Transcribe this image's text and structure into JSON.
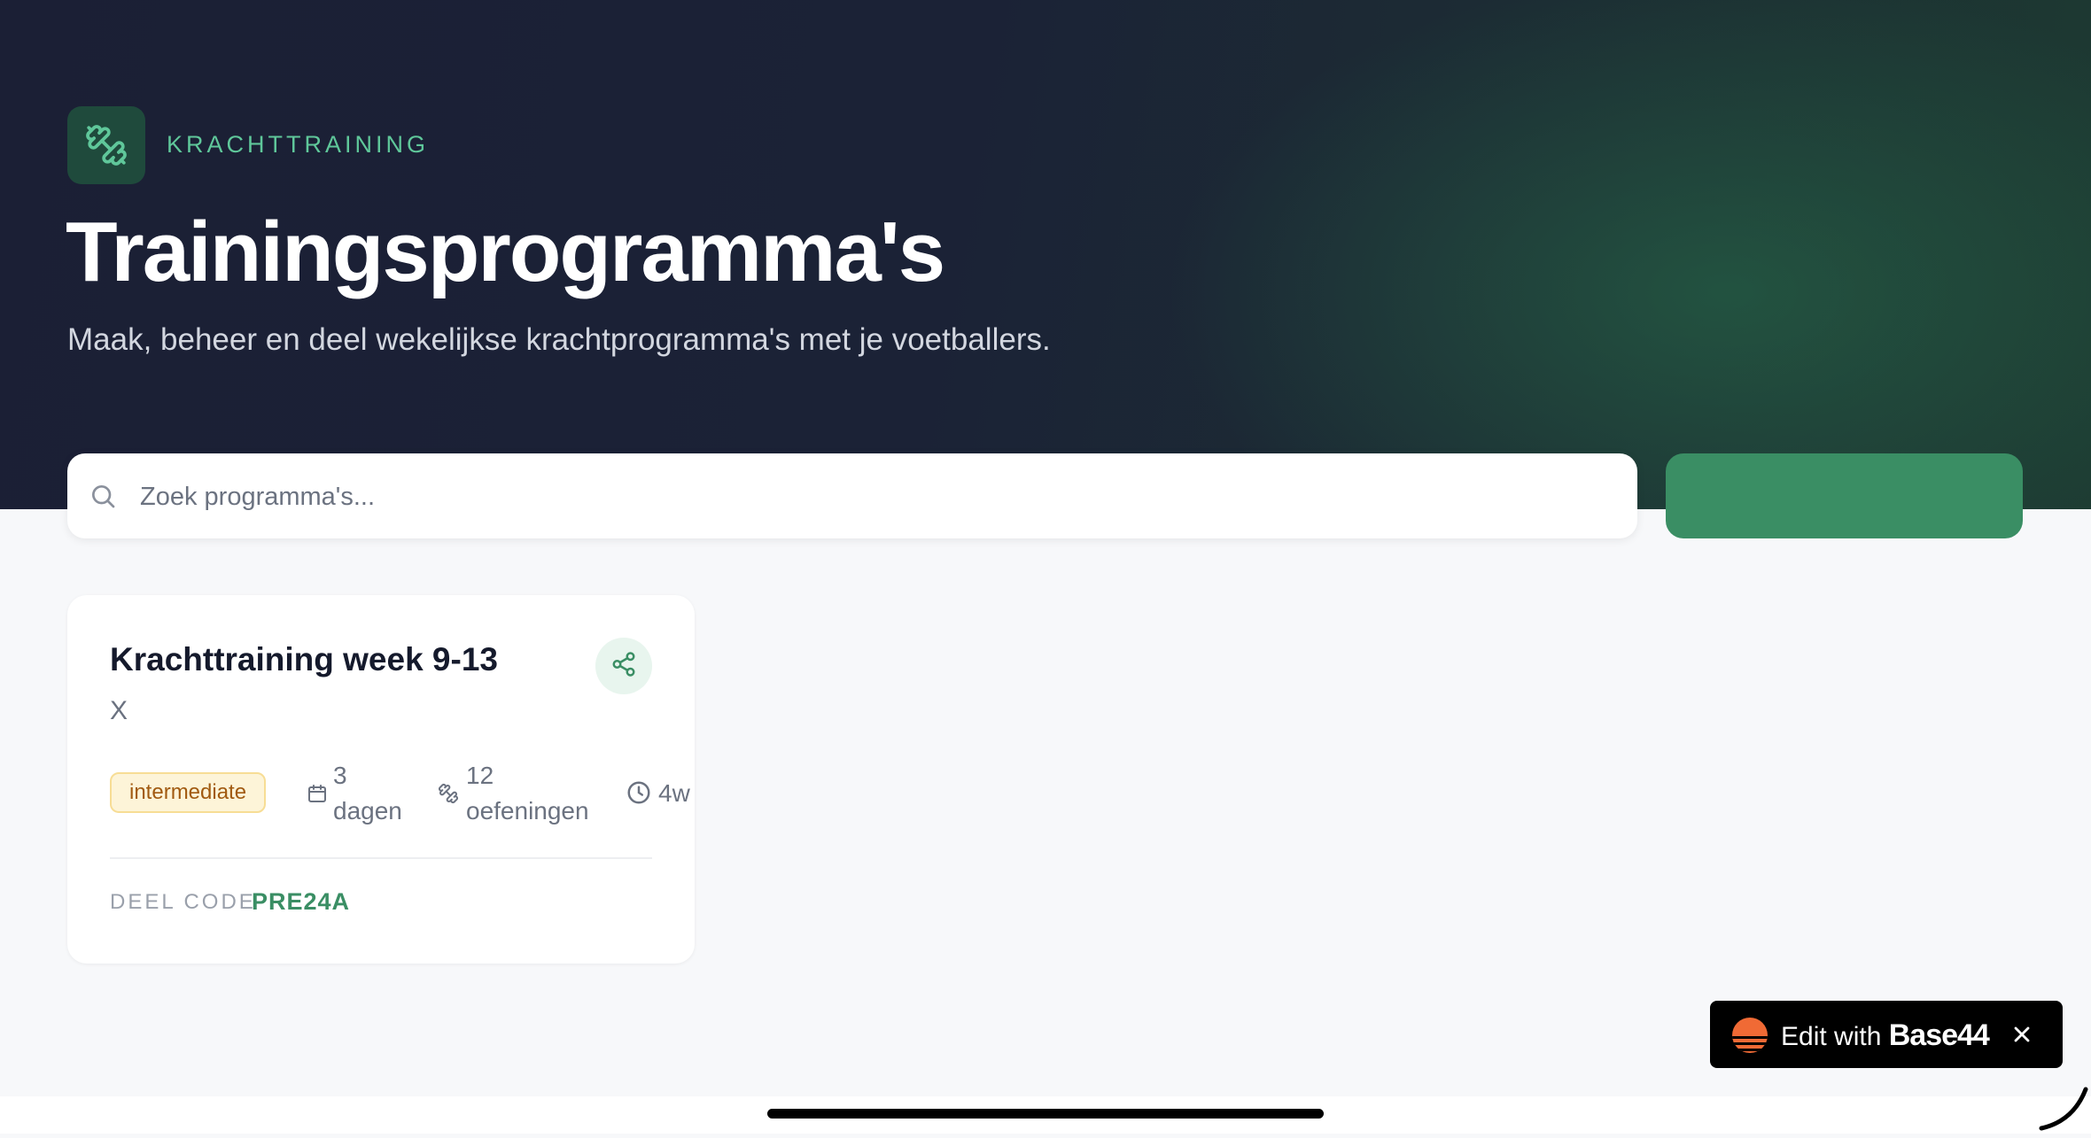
{
  "header": {
    "brand_label": "KRACHTTRAINING",
    "brand_icon": "dumbbell-icon",
    "title": "Trainingsprogramma's",
    "subtitle": "Maak, beheer en deel wekelijkse krachtprogramma's met je voetballers."
  },
  "search": {
    "placeholder": "Zoek programma's...",
    "icon": "search-icon"
  },
  "programs": [
    {
      "title": "Krachttraining week 9-13",
      "description": "X",
      "level": "intermediate",
      "days_value": "3",
      "days_unit": "dagen",
      "exercises_value": "12",
      "exercises_unit": "oefeningen",
      "weeks": "4w",
      "share_code_label": "DEEL CODE",
      "share_code": "PRE24A"
    }
  ],
  "base44": {
    "prefix": "Edit with",
    "brand": "Base44"
  },
  "colors": {
    "accent": "#3a8e64",
    "accent_light": "#5fc79a",
    "hero_dark": "#1b1f35",
    "badge_bg": "#fdf4d8",
    "badge_text": "#a15a10"
  }
}
